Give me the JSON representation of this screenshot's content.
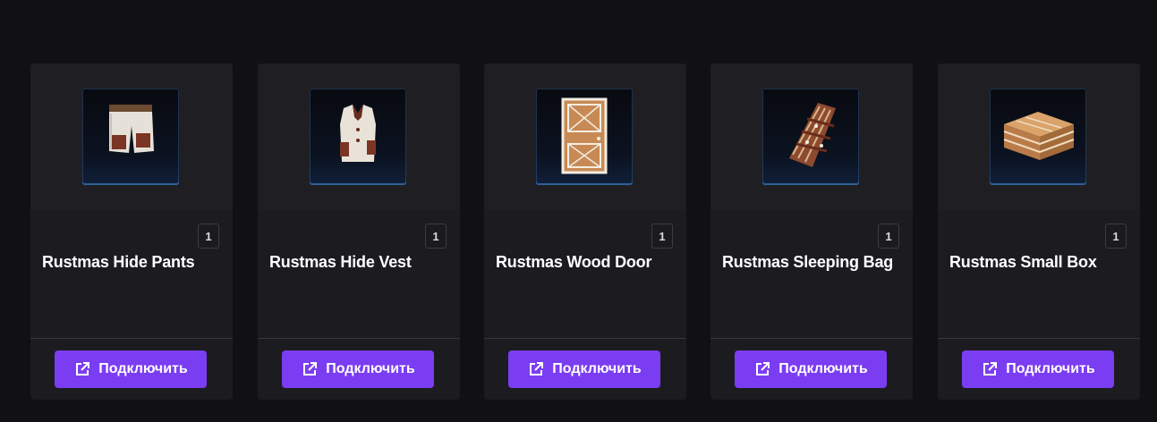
{
  "items": [
    {
      "name": "Rustmas Hide Pants",
      "quantity": "1",
      "button_label": "Подключить",
      "icon": "hide-pants-icon"
    },
    {
      "name": "Rustmas Hide Vest",
      "quantity": "1",
      "button_label": "Подключить",
      "icon": "hide-vest-icon"
    },
    {
      "name": "Rustmas Wood Door",
      "quantity": "1",
      "button_label": "Подключить",
      "icon": "wood-door-icon"
    },
    {
      "name": "Rustmas Sleeping Bag",
      "quantity": "1",
      "button_label": "Подключить",
      "icon": "sleeping-bag-icon"
    },
    {
      "name": "Rustmas Small Box",
      "quantity": "1",
      "button_label": "Подключить",
      "icon": "small-box-icon"
    }
  ],
  "colors": {
    "background": "#111114",
    "card": "#1c1c20",
    "button": "#7b3df2",
    "thumb_border": "#2f5f98"
  },
  "button_icon": "external-link-icon"
}
